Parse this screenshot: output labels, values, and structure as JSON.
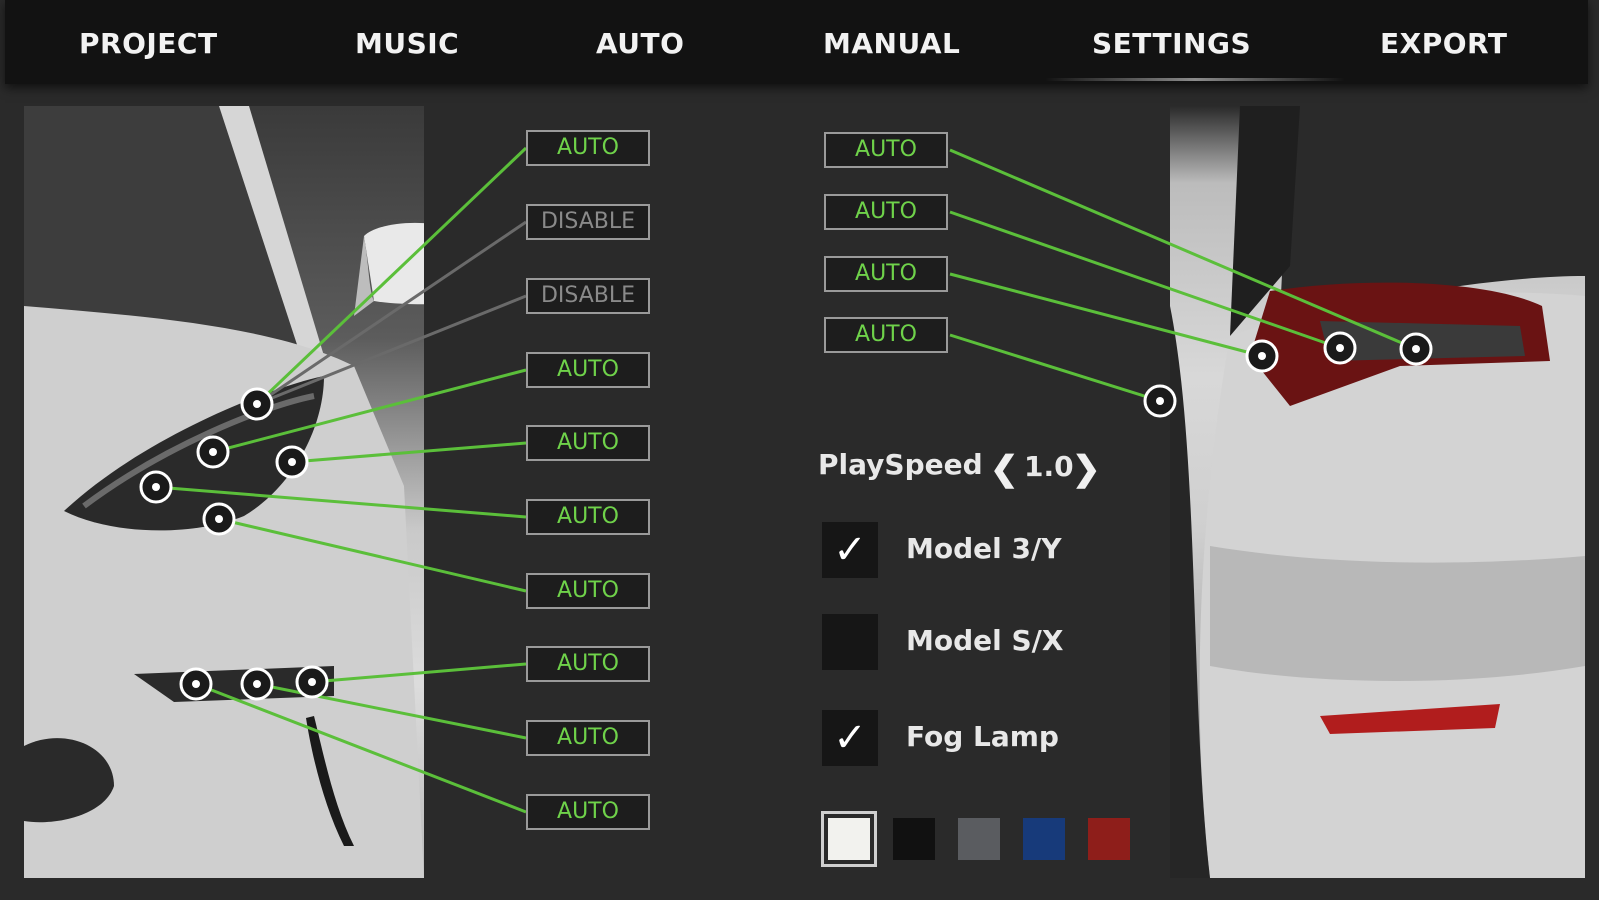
{
  "nav": {
    "project": "PROJECT",
    "music": "MUSIC",
    "auto": "AUTO",
    "manual": "MANUAL",
    "settings": "SETTINGS",
    "export": "EXPORT"
  },
  "front_channels": [
    {
      "label": "AUTO",
      "state": "auto"
    },
    {
      "label": "DISABLE",
      "state": "disabled"
    },
    {
      "label": "DISABLE",
      "state": "disabled"
    },
    {
      "label": "AUTO",
      "state": "auto"
    },
    {
      "label": "AUTO",
      "state": "auto"
    },
    {
      "label": "AUTO",
      "state": "auto"
    },
    {
      "label": "AUTO",
      "state": "auto"
    },
    {
      "label": "AUTO",
      "state": "auto"
    },
    {
      "label": "AUTO",
      "state": "auto"
    },
    {
      "label": "AUTO",
      "state": "auto"
    }
  ],
  "rear_channels": [
    {
      "label": "AUTO",
      "state": "auto"
    },
    {
      "label": "AUTO",
      "state": "auto"
    },
    {
      "label": "AUTO",
      "state": "auto"
    },
    {
      "label": "AUTO",
      "state": "auto"
    }
  ],
  "playspeed": {
    "label": "PlaySpeed",
    "value": "1.0",
    "decrease_icon": "chevron-left-icon",
    "increase_icon": "chevron-right-icon"
  },
  "options": {
    "model3y": {
      "label": "Model 3/Y",
      "checked": true
    },
    "modelsx": {
      "label": "Model S/X",
      "checked": false
    },
    "foglamp": {
      "label": "Fog Lamp",
      "checked": true
    }
  },
  "colors": {
    "accent_green": "#6fd24a",
    "swatches": [
      "#f2f2ee",
      "#111111",
      "#5a5c60",
      "#173a7a",
      "#8e1e1a"
    ],
    "selected_swatch": "#f2f2ee"
  }
}
